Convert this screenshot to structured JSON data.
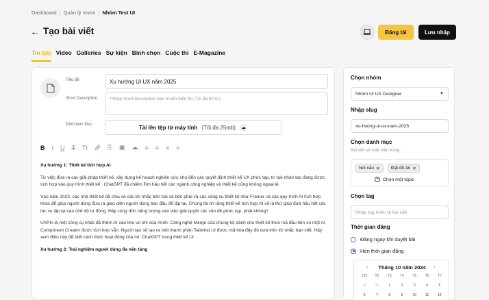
{
  "breadcrumb": {
    "items": [
      "Dashboard",
      "Quản lý nhóm",
      "Nhóm Test UI"
    ]
  },
  "header": {
    "title": "Tạo bài viết",
    "publish_label": "Đăng tải",
    "draft_label": "Lưu nháp"
  },
  "tabs": [
    "Tin tức",
    "Video",
    "Galleries",
    "Sự kiện",
    "Bình chọn",
    "Cuộc thi",
    "E-Magazine"
  ],
  "form": {
    "title_label": "Tiêu đề",
    "title_value": "Xu hướng UI UX năm 2025",
    "desc_label": "Short Description",
    "desc_placeholder": "*Nhập short description bạn muốn hiển thị (Tối đa 80 từ)",
    "attach_label": "Đính kèm files",
    "attach_button": "Tải lên tệp từ máy tính",
    "attach_hint": "(Tối đa 25mb)"
  },
  "toolbar": {
    "icons": [
      "bold-icon",
      "italic-icon",
      "underline-icon",
      "strikethrough-icon",
      "text-size-icon",
      "link-icon",
      "attachment-icon",
      "image-icon",
      "embed-icon",
      "align-left-icon",
      "align-center-icon",
      "align-right-icon",
      "justify-icon"
    ],
    "glyphs": [
      "B",
      "I",
      "U",
      "T",
      "TI",
      "🔗",
      "⎘",
      "▣",
      "☁",
      "≡",
      "≡",
      "≡",
      "≡"
    ]
  },
  "content": {
    "h1": "Xu hướng 1: Thiết kế tích hợp AI",
    "p1": "Từ việc đưa ra các giải pháp thiết kế, xây dựng kế hoạch nghiên cứu cho đến các quyết định thiết kế UX phức tạp, trí tuệ nhân tạo đang được tích hợp vào quy trình thiết kế . ChatGPT đã chiếm lĩnh hầu hết các ngành công nghiệp và thiết kế cũng không ngoại lệ.",
    "p2": "Vào năm 2023, các nhà thiết kế đã chia sẻ các lời nhắc bên trái và bên phải và các công cụ thiết kế như Framer và các quy trình AI tích hợp khác để giúp người dùng đưa ra giao diện người dùng ban đầu để lặp lại. Chúng tôi tin rằng thiết kế tích hợp AI sẽ là thứ giúp đưa hầu hết các tác vụ lặp lại vào chế độ tự động. Hãy cùng dồn năng lượng vào việc giải quyết các vấn đề phức tạp, phải không?",
    "p3": "UXPin là một công cụ khác đã thêm AI vào kho vũ khí của mình. Công nghệ Merge của chúng tôi dành cho thiết kế theo mã đầu tiên có một AI Component Creator được tích hợp sẵn. Người tạo sẽ tạo ra một thành phần Tailwind UI được mã hóa đầy đủ dựa trên lời nhắc bạn viết. Hãy xem điều này để biết cách thức hoạt động của nó: ChatGPT trong thiết kế UI",
    "h2": "Xu hướng 2: Trải nghiệm người dùng đa nền tảng"
  },
  "sidebar": {
    "group_label": "Chọn nhóm",
    "group_value": "Nhóm UI UX Designer",
    "slug_label": "Nhập slug",
    "slug_value": "xu-huong-ui-ux-nam-2025",
    "cat_label": "Chọn danh mục",
    "cat_hint": "Bài viết sẽ xuất hiện trong:",
    "chips": [
      "Nói xấu",
      "Đặt đồ ăn"
    ],
    "topic_label": "Chọn một topic",
    "tag_label": "Chọn tag",
    "tag_placeholder": "Nhập tag miêu tả bài viết",
    "time_label": "Thời gian đăng",
    "opt1": "Đăng ngay khi duyệt bài",
    "opt2": "Hẹn thời gian đăng",
    "cal_month": "Tháng 10 năm 2024",
    "weekdays": [
      "CN",
      "T2",
      "T3",
      "T4",
      "T5",
      "T6",
      "T7"
    ],
    "dates": [
      "29",
      "30",
      "1",
      "2",
      "3",
      "4",
      "5",
      "6",
      "7",
      "8",
      "9",
      "10",
      "11",
      "12"
    ]
  },
  "colors": {
    "accent": "#f0b400",
    "publish_bg": "#f5c542",
    "draft_bg": "#111111",
    "radio": "#1d4ed8"
  }
}
